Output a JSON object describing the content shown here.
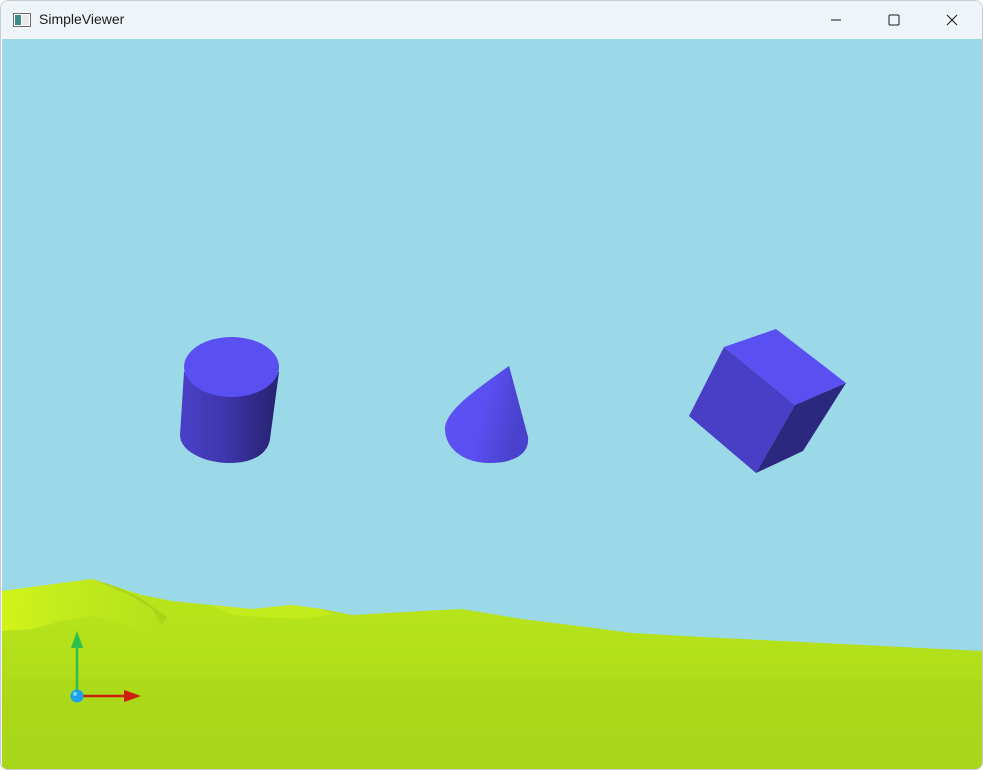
{
  "window": {
    "title": "SimpleViewer",
    "icon": "app-window-icon",
    "controls": {
      "minimize_icon": "minimize-icon",
      "maximize_icon": "maximize-icon",
      "close_icon": "close-icon"
    }
  },
  "scene": {
    "sky_color": "#9bd9e9",
    "ground_color": "#b3e21c",
    "shape_color": "#5b4ff0",
    "objects": [
      "cylinder",
      "cone",
      "cube"
    ],
    "axis_gizmo": {
      "x_color": "#cc1f10",
      "y_color": "#2fbf4f",
      "origin_color": "#1aa3e8"
    }
  }
}
